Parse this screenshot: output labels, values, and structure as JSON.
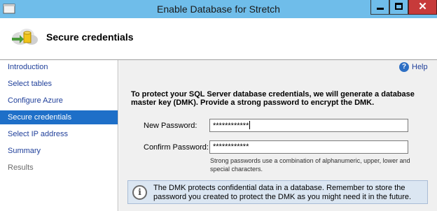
{
  "window": {
    "title": "Enable Database for Stretch",
    "close_glyph": "✕"
  },
  "header": {
    "title": "Secure credentials"
  },
  "sidebar": {
    "items": [
      {
        "label": "Introduction"
      },
      {
        "label": "Select tables"
      },
      {
        "label": "Configure Azure"
      },
      {
        "label": "Secure credentials"
      },
      {
        "label": "Select IP address"
      },
      {
        "label": "Summary"
      },
      {
        "label": "Results"
      }
    ],
    "active_index": 3
  },
  "help": {
    "label": "Help",
    "icon": "?"
  },
  "main": {
    "intro": "To protect your SQL Server database credentials, we will generate a database master key (DMK). Provide a strong password to encrypt the DMK.",
    "new_password_label": "New Password:",
    "new_password_value": "************",
    "confirm_password_label": "Confirm Password:",
    "confirm_password_value": "************",
    "hint": "Strong passwords use a combination of alphanumeric, upper, lower and special characters.",
    "info_icon": "i",
    "info_text": "The DMK protects confidential data in a database. Remember to store the password you created to protect the DMK as you might need it in the future."
  },
  "colors": {
    "titlebar": "#6fbdea",
    "active_nav": "#1e6fc8",
    "close_button": "#c73a3a",
    "info_box": "#dbe6f2"
  }
}
